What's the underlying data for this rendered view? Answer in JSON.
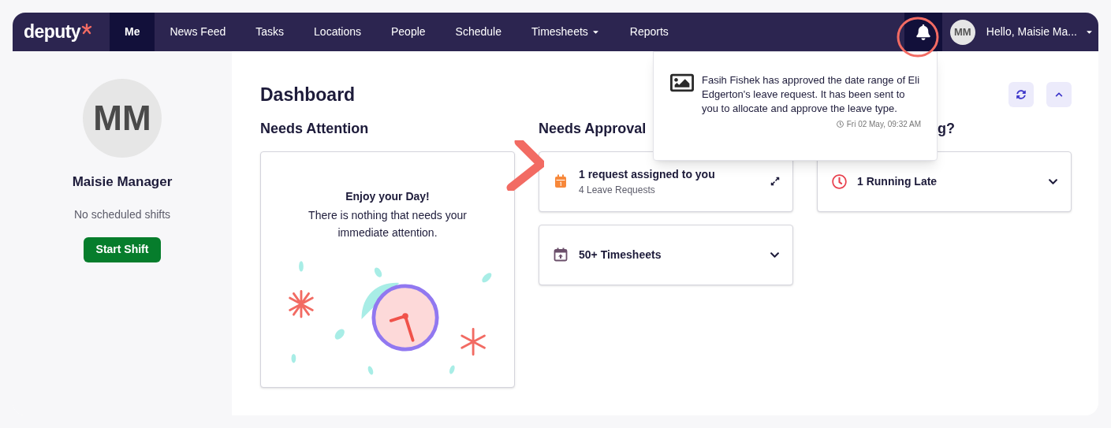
{
  "nav": {
    "logo": "deputy",
    "items": [
      {
        "label": "Me",
        "selected": true,
        "dropdown": false
      },
      {
        "label": "News Feed",
        "selected": false,
        "dropdown": false
      },
      {
        "label": "Tasks",
        "selected": false,
        "dropdown": false
      },
      {
        "label": "Locations",
        "selected": false,
        "dropdown": false
      },
      {
        "label": "People",
        "selected": false,
        "dropdown": false
      },
      {
        "label": "Schedule",
        "selected": false,
        "dropdown": false
      },
      {
        "label": "Timesheets",
        "selected": false,
        "dropdown": true
      },
      {
        "label": "Reports",
        "selected": false,
        "dropdown": false
      }
    ],
    "notifications_open": true,
    "user_initials": "MM",
    "user_greeting": "Hello, Maisie Ma..."
  },
  "profile": {
    "initials": "MM",
    "name": "Maisie Manager",
    "status": "No scheduled shifts",
    "button": "Start Shift"
  },
  "dashboard": {
    "title": "Dashboard",
    "columns": [
      {
        "heading": "Needs Attention",
        "cards": [
          {
            "kind": "empty",
            "title": "Enjoy your Day!",
            "text": "There is nothing that needs your immediate attention."
          }
        ]
      },
      {
        "heading": "Needs Approval",
        "cards": [
          {
            "kind": "request",
            "color": "#f7883a",
            "title": "1 request assigned to you",
            "subtitle": "4 Leave Requests"
          },
          {
            "kind": "collapsible",
            "color": "#6b4f6a",
            "title": "50+ Timesheets"
          }
        ]
      },
      {
        "heading": "g?",
        "cards": [
          {
            "kind": "collapsible",
            "color": "#e8424f",
            "title": "1 Running Late"
          }
        ]
      }
    ]
  },
  "notification": {
    "text": "Fasih Fishek has approved the date range of Eli Edgerton's leave request. It has been sent to you to allocate and approve the leave type.",
    "time": "Fri 02 May, 09:32 AM"
  }
}
